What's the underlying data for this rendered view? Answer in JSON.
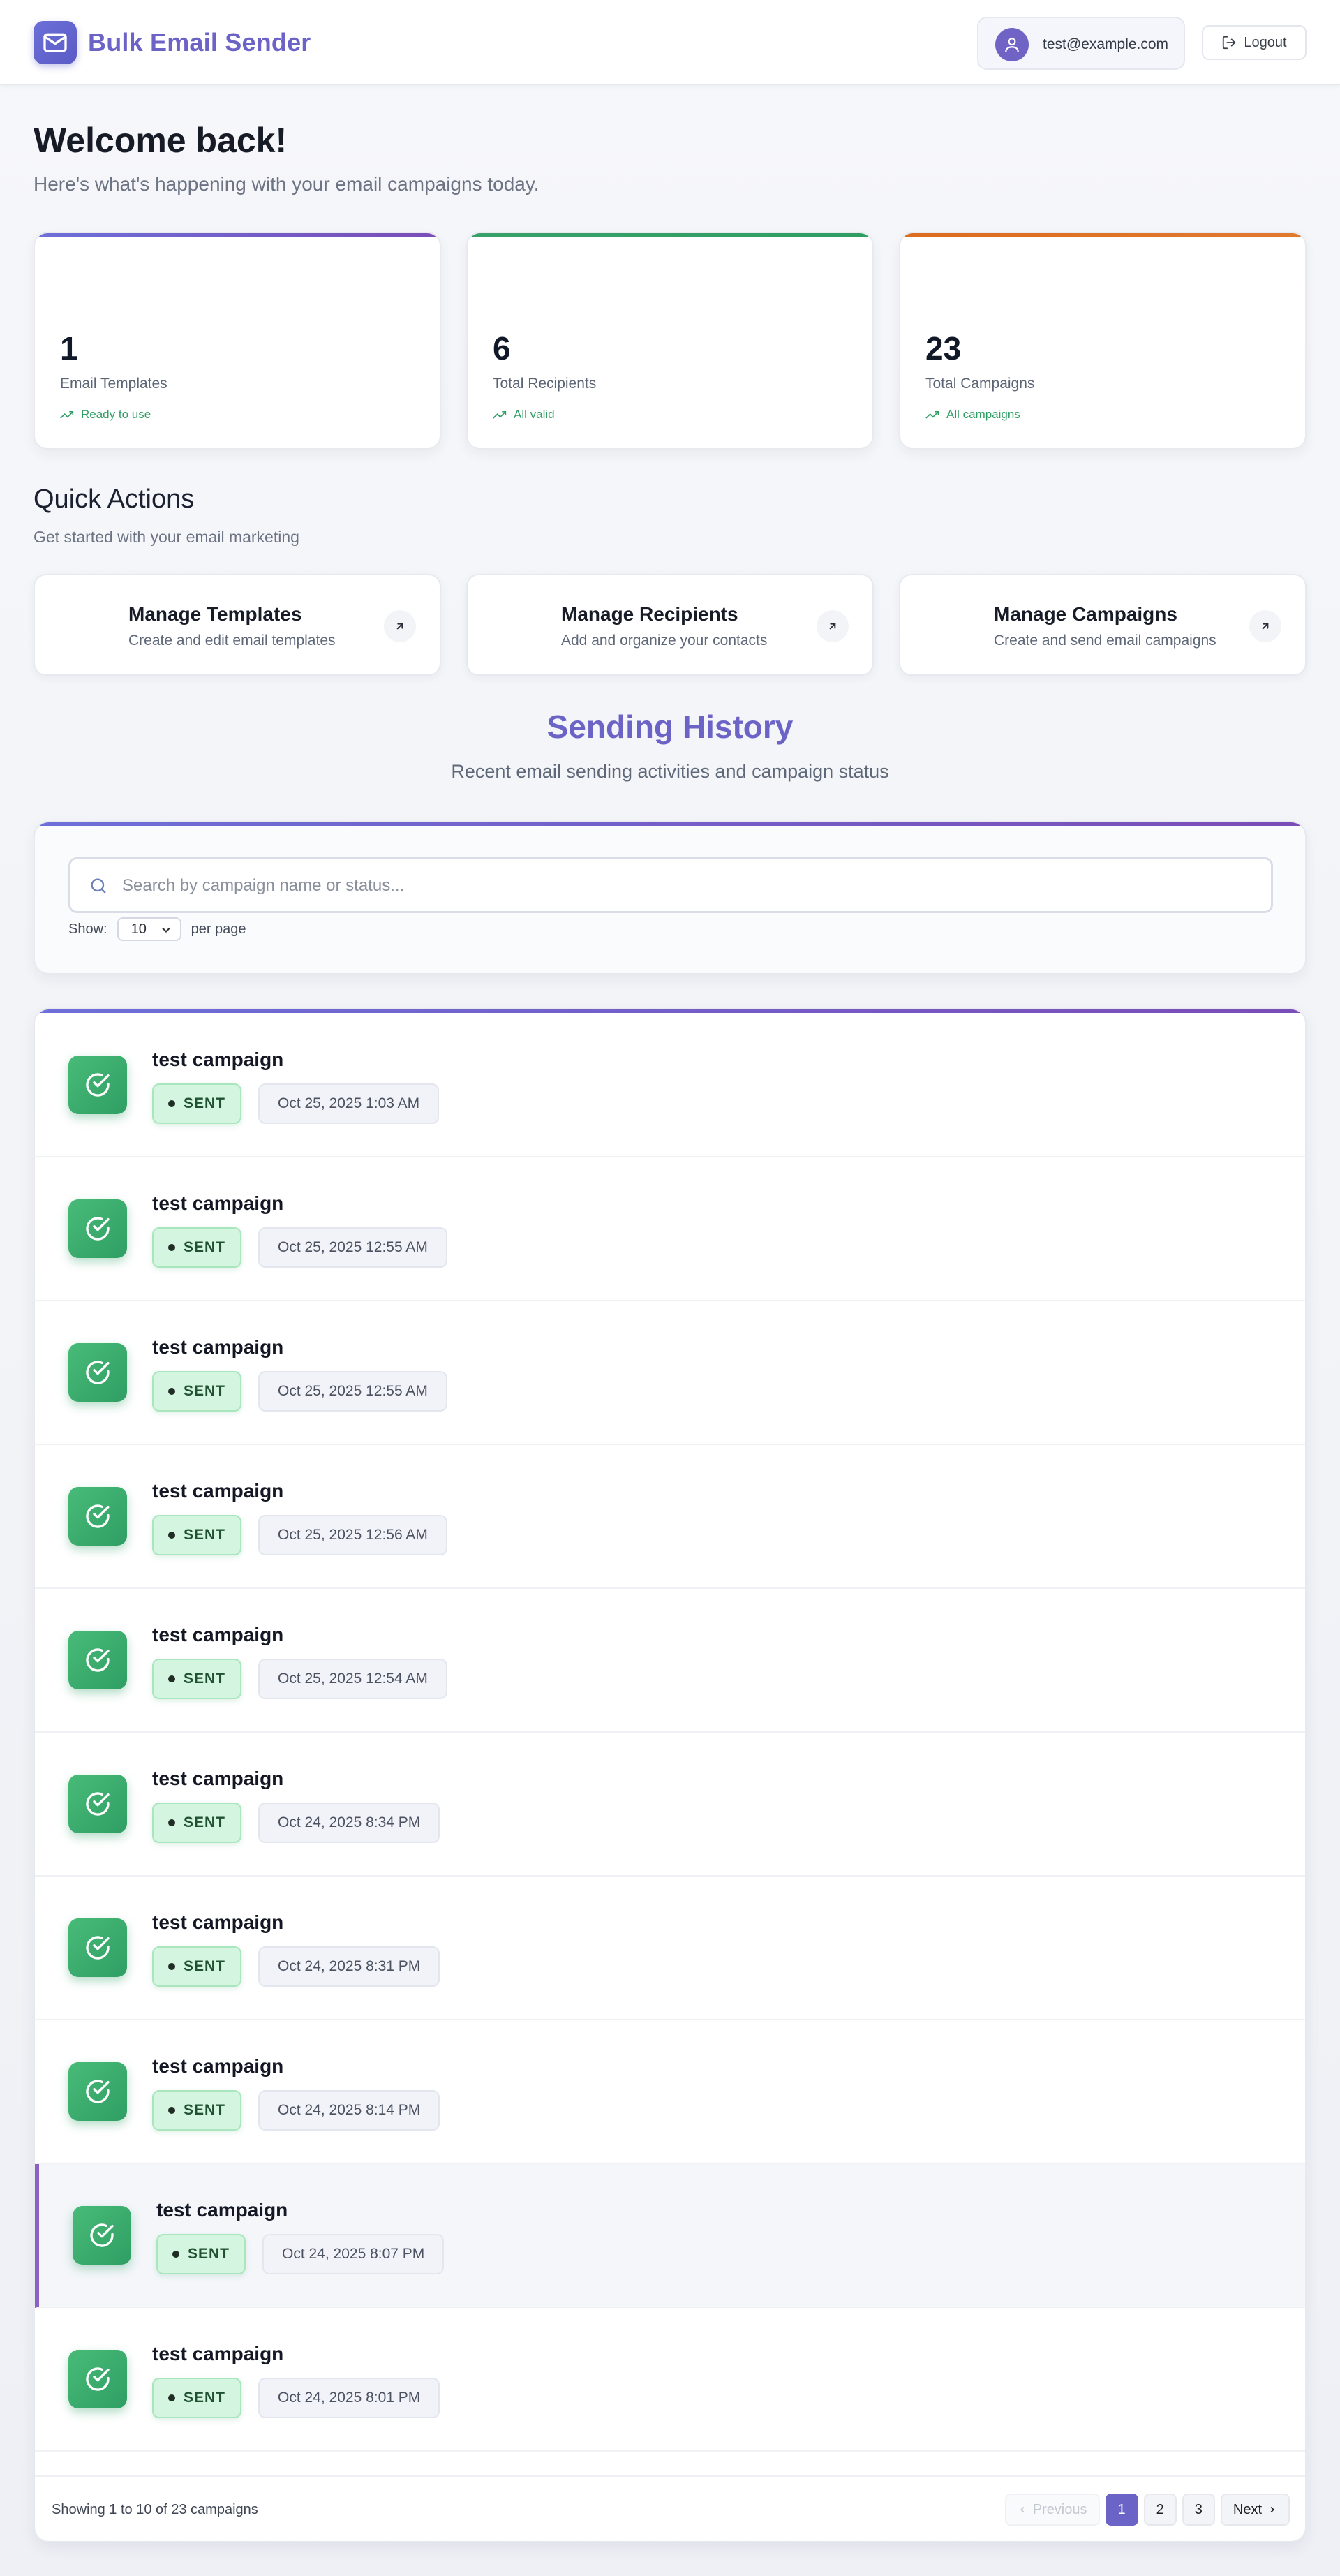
{
  "header": {
    "app_title": "Bulk Email Sender",
    "user_email": "test@example.com",
    "logout_label": "Logout"
  },
  "welcome": {
    "title": "Welcome back!",
    "subtitle": "Here's what's happening with your email campaigns today."
  },
  "stats": [
    {
      "value": "1",
      "label": "Email Templates",
      "trend": "Ready to use",
      "accent": "#6d6fd8"
    },
    {
      "value": "6",
      "label": "Total Recipients",
      "trend": "All valid",
      "accent": "#38a169"
    },
    {
      "value": "23",
      "label": "Total Campaigns",
      "trend": "All campaigns",
      "accent": "#dd6b20"
    }
  ],
  "quick_actions": {
    "title": "Quick Actions",
    "subtitle": "Get started with your email marketing",
    "items": [
      {
        "title": "Manage Templates",
        "desc": "Create and edit email templates"
      },
      {
        "title": "Manage Recipients",
        "desc": "Add and organize your contacts"
      },
      {
        "title": "Manage Campaigns",
        "desc": "Create and send email campaigns"
      }
    ]
  },
  "history": {
    "title": "Sending History",
    "subtitle": "Recent email sending activities and campaign status",
    "search_placeholder": "Search by campaign name or status...",
    "show_label": "Show:",
    "per_page_value": "10",
    "per_page_suffix": "per page",
    "rows": [
      {
        "name": "test campaign",
        "status": "SENT",
        "date": "Oct 25, 2025 1:03 AM"
      },
      {
        "name": "test campaign",
        "status": "SENT",
        "date": "Oct 25, 2025 12:55 AM"
      },
      {
        "name": "test campaign",
        "status": "SENT",
        "date": "Oct 25, 2025 12:55 AM"
      },
      {
        "name": "test campaign",
        "status": "SENT",
        "date": "Oct 25, 2025 12:56 AM"
      },
      {
        "name": "test campaign",
        "status": "SENT",
        "date": "Oct 25, 2025 12:54 AM"
      },
      {
        "name": "test campaign",
        "status": "SENT",
        "date": "Oct 24, 2025 8:34 PM"
      },
      {
        "name": "test campaign",
        "status": "SENT",
        "date": "Oct 24, 2025 8:31 PM"
      },
      {
        "name": "test campaign",
        "status": "SENT",
        "date": "Oct 24, 2025 8:14 PM"
      },
      {
        "name": "test campaign",
        "status": "SENT",
        "date": "Oct 24, 2025 8:07 PM"
      },
      {
        "name": "test campaign",
        "status": "SENT",
        "date": "Oct 24, 2025 8:01 PM"
      }
    ],
    "footer_text": "Showing 1 to 10 of 23 campaigns",
    "pagination": {
      "previous": "Previous",
      "pages": [
        "1",
        "2",
        "3"
      ],
      "next": "Next"
    }
  }
}
